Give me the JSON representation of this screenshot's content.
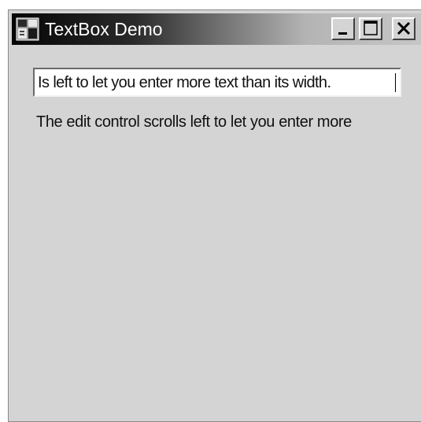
{
  "window": {
    "title": "TextBox Demo",
    "icon": "application-icon",
    "controls": {
      "minimize_icon": "minimize-icon",
      "maximize_icon": "maximize-icon",
      "close_icon": "close-icon"
    }
  },
  "textbox": {
    "value": "Is left to let you enter more text than its width."
  },
  "label": {
    "text": "The edit control scrolls left to let you enter more"
  },
  "colors": {
    "window_bg": "#d4d4d4",
    "title_text": "#ffffff",
    "textbox_bg": "#ffffff"
  }
}
